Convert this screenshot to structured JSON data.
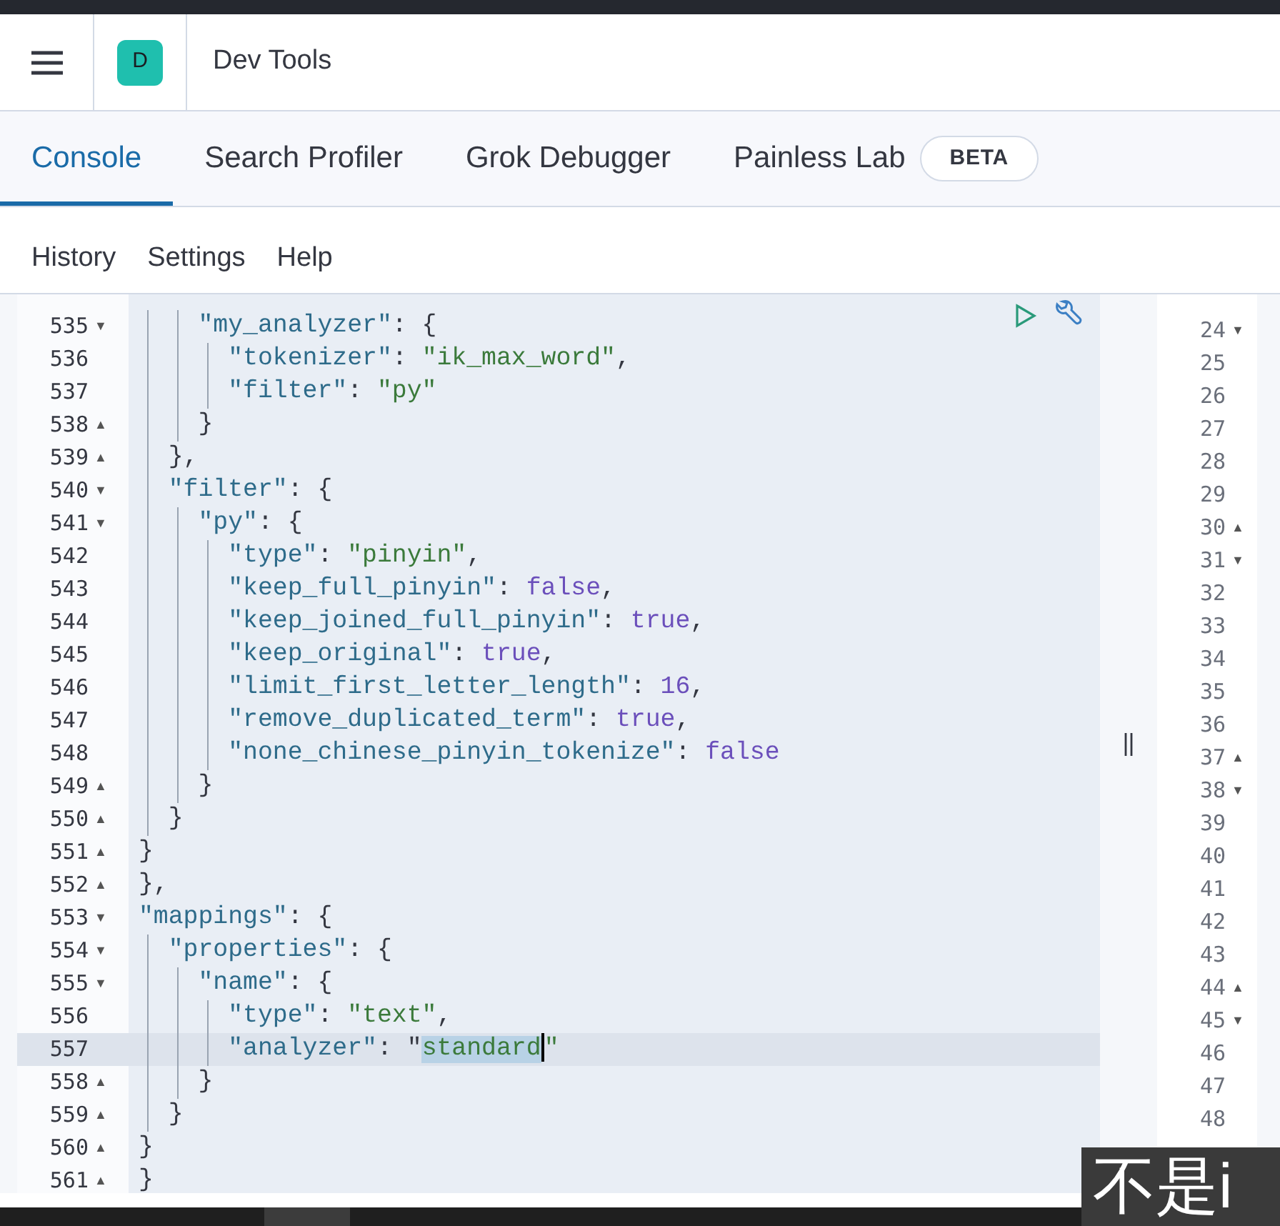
{
  "header": {
    "avatar": "D",
    "title": "Dev Tools"
  },
  "tabs": [
    {
      "label": "Console",
      "selected": true
    },
    {
      "label": "Search Profiler",
      "selected": false
    },
    {
      "label": "Grok Debugger",
      "selected": false
    },
    {
      "label": "Painless Lab",
      "selected": false,
      "badge": "BETA"
    }
  ],
  "menu": [
    "History",
    "Settings",
    "Help"
  ],
  "editor": {
    "lines": [
      {
        "number": "535",
        "fold": "▼",
        "code": "    \"my_analyzer\": {"
      },
      {
        "number": "536",
        "code": "      \"tokenizer\": \"ik_max_word\","
      },
      {
        "number": "537",
        "code": "      \"filter\": \"py\""
      },
      {
        "number": "538",
        "fold": "▲",
        "code": "    }"
      },
      {
        "number": "539",
        "fold": "▲",
        "code": "  },"
      },
      {
        "number": "540",
        "fold": "▼",
        "code": "  \"filter\": {"
      },
      {
        "number": "541",
        "fold": "▼",
        "code": "    \"py\": {"
      },
      {
        "number": "542",
        "code": "      \"type\": \"pinyin\","
      },
      {
        "number": "543",
        "code": "      \"keep_full_pinyin\": false,"
      },
      {
        "number": "544",
        "code": "      \"keep_joined_full_pinyin\": true,"
      },
      {
        "number": "545",
        "code": "      \"keep_original\": true,"
      },
      {
        "number": "546",
        "code": "      \"limit_first_letter_length\": 16,"
      },
      {
        "number": "547",
        "code": "      \"remove_duplicated_term\": true,"
      },
      {
        "number": "548",
        "code": "      \"none_chinese_pinyin_tokenize\": false"
      },
      {
        "number": "549",
        "fold": "▲",
        "code": "    }"
      },
      {
        "number": "550",
        "fold": "▲",
        "code": "  }"
      },
      {
        "number": "551",
        "fold": "▲",
        "code": "}"
      },
      {
        "number": "552",
        "fold": "▲",
        "code": "},"
      },
      {
        "number": "553",
        "fold": "▼",
        "code": "\"mappings\": {"
      },
      {
        "number": "554",
        "fold": "▼",
        "code": "  \"properties\": {"
      },
      {
        "number": "555",
        "fold": "▼",
        "code": "    \"name\": {"
      },
      {
        "number": "556",
        "code": "      \"type\": \"text\","
      },
      {
        "number": "557",
        "code": "      \"analyzer\": \"",
        "code_selected": "standard",
        "code_after": "\"",
        "active": true
      },
      {
        "number": "558",
        "fold": "▲",
        "code": "    }"
      },
      {
        "number": "559",
        "fold": "▲",
        "code": "  }"
      },
      {
        "number": "560",
        "fold": "▲",
        "code": "}"
      },
      {
        "number": "561",
        "fold": "▲",
        "code": "}"
      }
    ]
  },
  "output_lines": [
    {
      "number": "24",
      "fold": "▼"
    },
    {
      "number": "25"
    },
    {
      "number": "26"
    },
    {
      "number": "27"
    },
    {
      "number": "28"
    },
    {
      "number": "29"
    },
    {
      "number": "30",
      "fold": "▲"
    },
    {
      "number": "31",
      "fold": "▼"
    },
    {
      "number": "32"
    },
    {
      "number": "33"
    },
    {
      "number": "34"
    },
    {
      "number": "35"
    },
    {
      "number": "36"
    },
    {
      "number": "37",
      "fold": "▲"
    },
    {
      "number": "38",
      "fold": "▼"
    },
    {
      "number": "39"
    },
    {
      "number": "40"
    },
    {
      "number": "41"
    },
    {
      "number": "42"
    },
    {
      "number": "43"
    },
    {
      "number": "44",
      "fold": "▲"
    },
    {
      "number": "45",
      "fold": "▼"
    },
    {
      "number": "46"
    },
    {
      "number": "47"
    },
    {
      "number": "48"
    }
  ],
  "caption": "不是i"
}
